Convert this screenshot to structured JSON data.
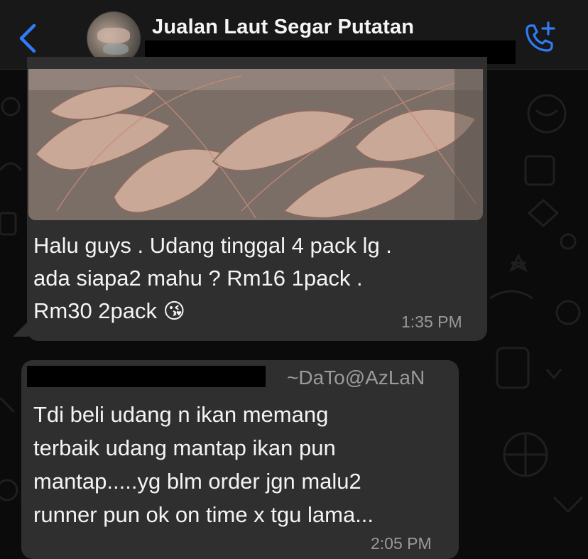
{
  "header": {
    "title": "Jualan Laut Segar Putatan",
    "back_icon": "chevron-left-icon",
    "call_icon": "phone-add-icon",
    "accent_color": "#2f7cf6"
  },
  "messages": [
    {
      "type": "image-with-caption",
      "image": "shrimp-photo",
      "lines": [
        "Halu guys . Udang tinggal 4 pack lg .",
        "ada siapa2 mahu ? Rm16 1pack .",
        "Rm30 2pack"
      ],
      "emoji": "😘",
      "time": "1:35 PM"
    },
    {
      "type": "text",
      "sender": "~DaTo@AzLaN",
      "lines": [
        "Tdi beli udang n ikan memang",
        "terbaik udang mantap ikan pun",
        "mantap.....yg blm order jgn malu2",
        "runner pun ok on time x tgu lama..."
      ],
      "time": "2:05 PM"
    }
  ],
  "colors": {
    "background": "#0b0b0b",
    "header_bg": "#181818",
    "bubble_bg": "#2f2f2f",
    "timestamp": "#9a9a9a"
  }
}
